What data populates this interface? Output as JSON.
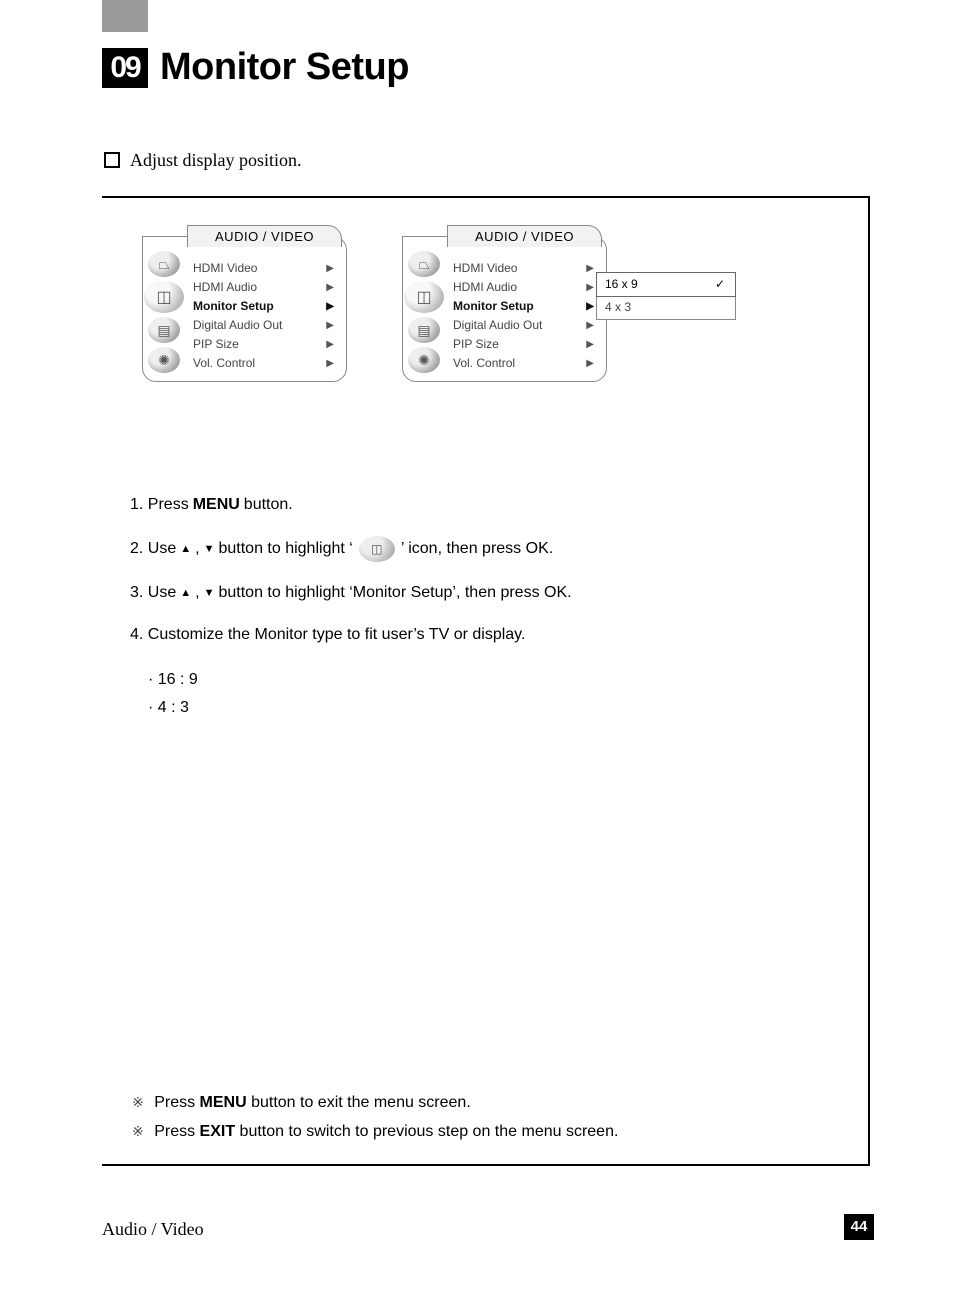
{
  "section": {
    "number": "09",
    "title": "Monitor Setup"
  },
  "intro": "Adjust display position.",
  "osd": {
    "tab_title": "AUDIO / VIDEO",
    "icons": [
      "tv-icon",
      "av-icon",
      "film-icon",
      "gear-icon"
    ],
    "items": [
      {
        "label": "HDMI Video",
        "selected": false
      },
      {
        "label": "HDMI Audio",
        "selected": false
      },
      {
        "label": "Monitor Setup",
        "selected": true
      },
      {
        "label": "Digital Audio Out",
        "selected": false
      },
      {
        "label": "PIP Size",
        "selected": false
      },
      {
        "label": "Vol. Control",
        "selected": false
      }
    ],
    "submenu": [
      {
        "label": "16 x 9",
        "checked": true,
        "selected": true
      },
      {
        "label": "4 x 3",
        "checked": false,
        "selected": false
      }
    ]
  },
  "steps": {
    "s1_a": "1. Press ",
    "s1_bold": "MENU",
    "s1_b": " button.",
    "s2_a": "2. Use ",
    "s2_b": " button to highlight ‘",
    "s2_c": "’  icon, then press OK.",
    "s3_a": "3. Use ",
    "s3_b": " button to highlight ‘Monitor Setup’, then press OK.",
    "s4": "4. Customize the Monitor type to fit user’s TV or display.",
    "s4_opt1": "· 16 : 9",
    "s4_opt2": "· 4 : 3"
  },
  "notes": {
    "n1_a": "Press ",
    "n1_bold": "MENU",
    "n1_b": " button to exit the menu screen.",
    "n2_a": "Press ",
    "n2_bold": "EXIT",
    "n2_b": " button to switch to previous step on the menu screen."
  },
  "footer": {
    "category": "Audio / Video",
    "page": "44"
  },
  "glyph": {
    "arrow_right": "▶",
    "arrow_up": "▲",
    "arrow_down": "▼",
    "check": "✓",
    "ref": "※",
    "comma": ","
  }
}
